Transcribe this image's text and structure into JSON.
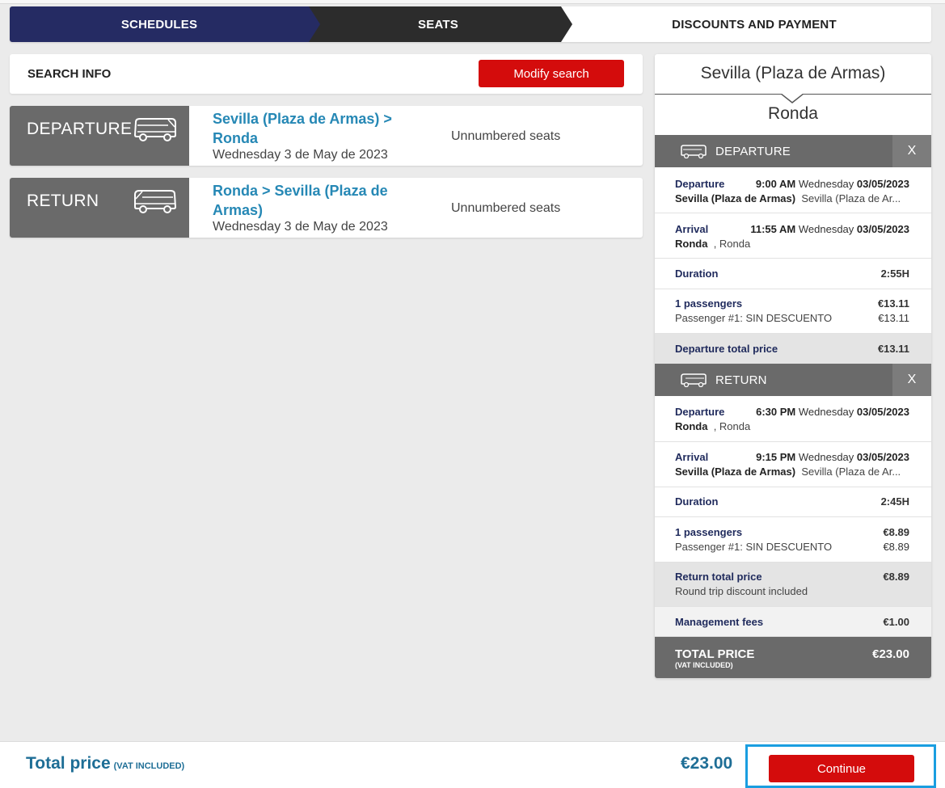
{
  "steps": [
    {
      "label": "SCHEDULES"
    },
    {
      "label": "SEATS"
    },
    {
      "label": "DISCOUNTS AND PAYMENT"
    }
  ],
  "search_info": {
    "title": "SEARCH INFO",
    "modify_label": "Modify search"
  },
  "trips": {
    "departure": {
      "label": "DEPARTURE",
      "route": "Sevilla (Plaza de Armas) > Ronda",
      "date": "Wednesday 3 de May de 2023",
      "seats": "Unnumbered seats"
    },
    "return": {
      "label": "RETURN",
      "route": "Ronda > Sevilla (Plaza de Armas)",
      "date": "Wednesday 3 de May de 2023",
      "seats": "Unnumbered seats"
    }
  },
  "summary": {
    "origin": "Sevilla (Plaza de Armas)",
    "destination": "Ronda",
    "departure": {
      "header": "DEPARTURE",
      "close": "X",
      "departure_label": "Departure",
      "departure_time": "9:00 AM",
      "departure_day": "Wednesday",
      "departure_date": "03/05/2023",
      "departure_station": "Sevilla (Plaza de Armas)",
      "departure_station_detail": "Sevilla (Plaza de Ar...",
      "arrival_label": "Arrival",
      "arrival_time": "11:55 AM",
      "arrival_day": "Wednesday",
      "arrival_date": "03/05/2023",
      "arrival_station": "Ronda",
      "arrival_station_detail": ", Ronda",
      "duration_label": "Duration",
      "duration": "2:55H",
      "passengers_label": "1 passengers",
      "passengers_total": "€13.11",
      "passenger_line": "Passenger #1: SIN DESCUENTO",
      "passenger_price": "€13.11",
      "total_label": "Departure total price",
      "total": "€13.11"
    },
    "return": {
      "header": "RETURN",
      "close": "X",
      "departure_label": "Departure",
      "departure_time": "6:30 PM",
      "departure_day": "Wednesday",
      "departure_date": "03/05/2023",
      "departure_station": "Ronda",
      "departure_station_detail": ", Ronda",
      "arrival_label": "Arrival",
      "arrival_time": "9:15 PM",
      "arrival_day": "Wednesday",
      "arrival_date": "03/05/2023",
      "arrival_station": "Sevilla (Plaza de Armas)",
      "arrival_station_detail": "Sevilla (Plaza de Ar...",
      "duration_label": "Duration",
      "duration": "2:45H",
      "passengers_label": "1 passengers",
      "passengers_total": "€8.89",
      "passenger_line": "Passenger #1: SIN DESCUENTO",
      "passenger_price": "€8.89",
      "total_label": "Return total price",
      "total": "€8.89",
      "discount_note": "Round trip discount included"
    },
    "fees_label": "Management fees",
    "fees": "€1.00",
    "total_label": "TOTAL PRICE",
    "total_vat": "(VAT INCLUDED)",
    "total": "€23.00"
  },
  "bottom": {
    "total_label": "Total price",
    "vat_label": "(VAT INCLUDED)",
    "total": "€23.00",
    "continue_label": "Continue"
  },
  "colors": {
    "navy": "#252b63",
    "dark": "#2c2c2c",
    "grey": "#6a6a6a",
    "accent_red": "#d40c0c",
    "link_blue": "#2688b5",
    "focus_blue": "#1a9ee0"
  }
}
